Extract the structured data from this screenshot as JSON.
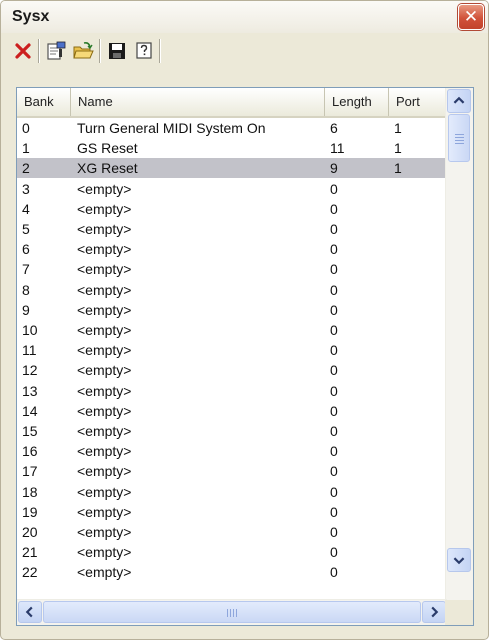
{
  "window": {
    "title": "Sysx"
  },
  "toolbar": {
    "buttons": [
      {
        "icon": "delete-icon"
      },
      {
        "icon": "properties-icon"
      },
      {
        "icon": "open-folder-icon"
      },
      {
        "icon": "save-icon"
      },
      {
        "icon": "help-icon"
      }
    ]
  },
  "table": {
    "columns": [
      "Bank",
      "Name",
      "Length",
      "Port"
    ],
    "selected_row": 2,
    "rows": [
      {
        "bank": "0",
        "name": "Turn General MIDI System On",
        "length": "6",
        "port": "1"
      },
      {
        "bank": "1",
        "name": "GS Reset",
        "length": "11",
        "port": "1"
      },
      {
        "bank": "2",
        "name": "XG Reset",
        "length": "9",
        "port": "1"
      },
      {
        "bank": "3",
        "name": "<empty>",
        "length": "0",
        "port": ""
      },
      {
        "bank": "4",
        "name": "<empty>",
        "length": "0",
        "port": ""
      },
      {
        "bank": "5",
        "name": "<empty>",
        "length": "0",
        "port": ""
      },
      {
        "bank": "6",
        "name": "<empty>",
        "length": "0",
        "port": ""
      },
      {
        "bank": "7",
        "name": "<empty>",
        "length": "0",
        "port": ""
      },
      {
        "bank": "8",
        "name": "<empty>",
        "length": "0",
        "port": ""
      },
      {
        "bank": "9",
        "name": "<empty>",
        "length": "0",
        "port": ""
      },
      {
        "bank": "10",
        "name": "<empty>",
        "length": "0",
        "port": ""
      },
      {
        "bank": "11",
        "name": "<empty>",
        "length": "0",
        "port": ""
      },
      {
        "bank": "12",
        "name": "<empty>",
        "length": "0",
        "port": ""
      },
      {
        "bank": "13",
        "name": "<empty>",
        "length": "0",
        "port": ""
      },
      {
        "bank": "14",
        "name": "<empty>",
        "length": "0",
        "port": ""
      },
      {
        "bank": "15",
        "name": "<empty>",
        "length": "0",
        "port": ""
      },
      {
        "bank": "16",
        "name": "<empty>",
        "length": "0",
        "port": ""
      },
      {
        "bank": "17",
        "name": "<empty>",
        "length": "0",
        "port": ""
      },
      {
        "bank": "18",
        "name": "<empty>",
        "length": "0",
        "port": ""
      },
      {
        "bank": "19",
        "name": "<empty>",
        "length": "0",
        "port": ""
      },
      {
        "bank": "20",
        "name": "<empty>",
        "length": "0",
        "port": ""
      },
      {
        "bank": "21",
        "name": "<empty>",
        "length": "0",
        "port": ""
      },
      {
        "bank": "22",
        "name": "<empty>",
        "length": "0",
        "port": ""
      }
    ]
  },
  "colors": {
    "selection": "#c2c2c9",
    "close_button": "#d1523a",
    "delete_icon": "#cc1f1f",
    "scrollbar": "#c4d4f4"
  }
}
